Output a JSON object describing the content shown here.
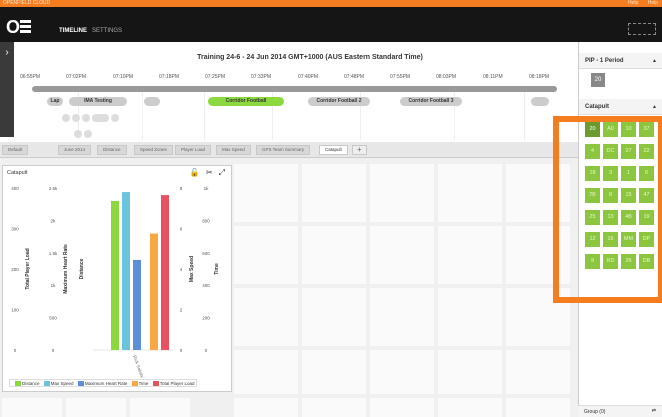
{
  "topbar": {
    "brand": "OPENFIELD CLOUD",
    "links": [
      "Help",
      "Help"
    ]
  },
  "nav": {
    "logo": "O",
    "timeline": "TIMELINE",
    "settings": "SETTINGS"
  },
  "timeline": {
    "title": "Training 24-6 - 24 Jun 2014 GMT+1000 (AUS Eastern Standard Time)",
    "times": [
      "06:55PM",
      "07:02PM",
      "07:10PM",
      "07:18PM",
      "07:25PM",
      "07:33PM",
      "07:40PM",
      "07:48PM",
      "07:55PM",
      "08:03PM",
      "08:11PM",
      "08:18PM"
    ],
    "periods": [
      "Lap",
      "IMA Testing",
      "",
      "Corridor Football",
      "Corridor Football 2",
      "Corridor Football 3",
      ""
    ]
  },
  "tabs": [
    "Default",
    "June 2014",
    "Distance",
    "Speed Zones",
    "Player Load",
    "Max Speed",
    "GPS Team Summary",
    "Catapult",
    "+"
  ],
  "active_tab": "Catapult",
  "widget": {
    "title": "Catapult",
    "icons": [
      "lock-icon",
      "pin-icon",
      "expand-icon"
    ],
    "legend": [
      "Distance",
      "Max Speed",
      "Maximum Heart Rate",
      "Time",
      "Total Player Load"
    ]
  },
  "chart_data": {
    "type": "bar",
    "categories": [
      "Rick Salisbury"
    ],
    "series": [
      {
        "name": "Distance",
        "values": [
          2300
        ],
        "color": "#8cd93f"
      },
      {
        "name": "Max Speed",
        "values": [
          7.8
        ],
        "color": "#6cc4dc"
      },
      {
        "name": "Maximum Heart Rate",
        "values": [
          1390
        ],
        "color": "#5b8fd6"
      },
      {
        "name": "Time",
        "values": [
          1150
        ],
        "color": "#f7a844"
      },
      {
        "name": "Total Player Load",
        "values": [
          1530
        ],
        "color": "#e8515f"
      }
    ],
    "axes": [
      {
        "label": "Total Player Load",
        "side": "left",
        "ticks": [
          "400",
          "300",
          "200",
          "100",
          "0"
        ],
        "range": [
          0,
          400
        ]
      },
      {
        "label": "Maximum Heart Rate",
        "side": "left",
        "ticks": [
          "2.5k",
          "2k",
          "1.5k",
          "1k",
          "500",
          "0"
        ],
        "range": [
          0,
          2500
        ]
      },
      {
        "label": "Distance",
        "side": "left",
        "ticks": [
          "",
          "",
          "",
          "",
          "",
          ""
        ]
      },
      {
        "label": "Max Speed",
        "side": "right",
        "ticks": [
          "8",
          "6",
          "4",
          "2",
          "0"
        ],
        "range": [
          0,
          8
        ]
      },
      {
        "label": "Time",
        "side": "right",
        "ticks": [
          "1k",
          "800",
          "600",
          "400",
          "200",
          "0"
        ],
        "range": [
          0,
          1000
        ]
      }
    ]
  },
  "sidebar": {
    "pip_title": "PIP - 1 Period",
    "pip_value": "20",
    "catapult_title": "Catapult",
    "grid": [
      "20",
      "A0",
      "10",
      "37",
      "4",
      "DC",
      "27",
      "22",
      "18",
      "3",
      "1",
      "6",
      "7B",
      "8",
      "15",
      "47",
      "25",
      "13",
      "4B",
      "19",
      "12",
      "16",
      "MM",
      "DP",
      "9",
      "RD",
      "26",
      "DB"
    ],
    "group_footer": "Group (0)"
  },
  "colors": {
    "accent": "#f57d1f",
    "player_green": "#8cc63f"
  }
}
